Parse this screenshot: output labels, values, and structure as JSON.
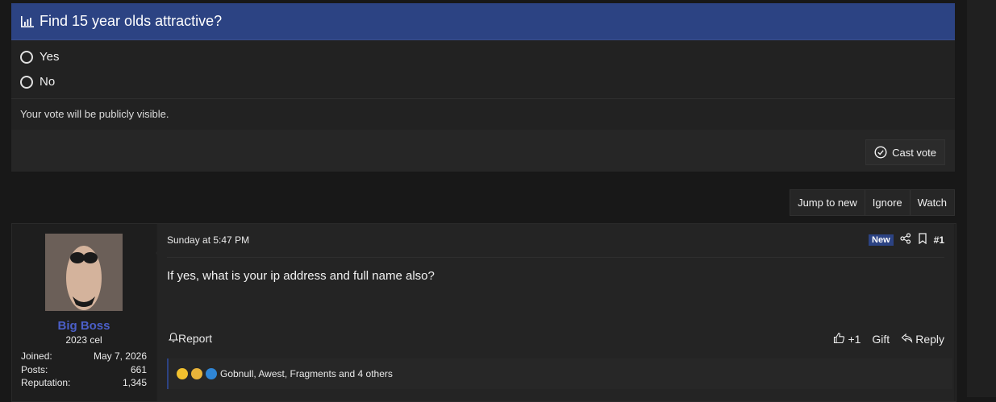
{
  "poll": {
    "title": "Find 15 year olds attractive?",
    "options": [
      "Yes",
      "No"
    ],
    "note": "Your vote will be publicly visible.",
    "cast_label": "Cast vote"
  },
  "thread_actions": [
    "Jump to new",
    "Ignore",
    "Watch"
  ],
  "post": {
    "username": "Big Boss",
    "user_title": "2023 cel",
    "stats": [
      {
        "label": "Joined:",
        "value": "May 7, 2026"
      },
      {
        "label": "Posts:",
        "value": "661"
      },
      {
        "label": "Reputation:",
        "value": "1,345"
      }
    ],
    "date": "Sunday at 5:47 PM",
    "badge": "New",
    "number": "#1",
    "body": "If yes, what is your ip address and full name also?",
    "report_label": "Report",
    "like_count": "+1",
    "gift_label": "Gift",
    "reply_label": "Reply",
    "reactions_text": "Gobnull, Awest, Fragments and 4 others"
  },
  "colors": {
    "accent": "#2c4383",
    "username": "#4b5fc8",
    "background": "#181818"
  }
}
